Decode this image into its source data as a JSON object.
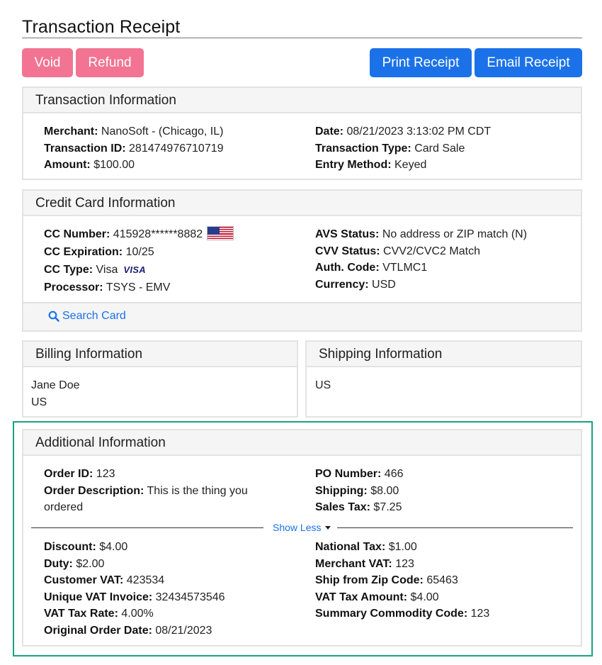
{
  "page": {
    "title": "Transaction Receipt"
  },
  "actions": {
    "void": "Void",
    "refund": "Refund",
    "print_receipt": "Print Receipt",
    "email_receipt": "Email Receipt"
  },
  "transaction": {
    "header": "Transaction Information",
    "merchant_label": "Merchant:",
    "merchant": "NanoSoft - (Chicago, IL)",
    "id_label": "Transaction ID:",
    "id": "281474976710719",
    "amount_label": "Amount:",
    "amount": "$100.00",
    "date_label": "Date:",
    "date": "08/21/2023 3:13:02 PM CDT",
    "type_label": "Transaction Type:",
    "type": "Card Sale",
    "entry_label": "Entry Method:",
    "entry": "Keyed"
  },
  "card": {
    "header": "Credit Card Information",
    "number_label": "CC Number:",
    "number": "415928******8882",
    "number_flag_icon": "us-flag-icon",
    "expiration_label": "CC Expiration:",
    "expiration": "10/25",
    "type_label": "CC Type:",
    "type": "Visa",
    "type_logo": "VISA",
    "processor_label": "Processor:",
    "processor": "TSYS - EMV",
    "avs_label": "AVS Status:",
    "avs": "No address or ZIP match (N)",
    "cvv_label": "CVV Status:",
    "cvv": "CVV2/CVC2 Match",
    "auth_label": "Auth. Code:",
    "auth": "VTLMC1",
    "currency_label": "Currency:",
    "currency": "USD",
    "search_card": "Search Card",
    "search_icon": "search-icon"
  },
  "billing": {
    "header": "Billing Information",
    "name": "Jane Doe",
    "country": "US"
  },
  "shipping": {
    "header": "Shipping Information",
    "country": "US"
  },
  "additional": {
    "header": "Additional Information",
    "order_id_label": "Order ID:",
    "order_id": "123",
    "order_desc_label": "Order Description:",
    "order_desc_line1": "This is the thing you",
    "order_desc_line2": "ordered",
    "po_label": "PO Number:",
    "po": "466",
    "shipping_label": "Shipping:",
    "shipping": "$8.00",
    "sales_tax_label": "Sales Tax:",
    "sales_tax": "$7.25",
    "show_less": "Show Less",
    "discount_label": "Discount:",
    "discount": "$4.00",
    "duty_label": "Duty:",
    "duty": "$2.00",
    "customer_vat_label": "Customer VAT:",
    "customer_vat": "423534",
    "unique_vat_label": "Unique VAT Invoice:",
    "unique_vat": "32434573546",
    "vat_rate_label": "VAT Tax Rate:",
    "vat_rate": "4.00%",
    "orig_date_label": "Original Order Date:",
    "orig_date": "08/21/2023",
    "national_tax_label": "National Tax:",
    "national_tax": "$1.00",
    "merchant_vat_label": "Merchant VAT:",
    "merchant_vat": "123",
    "ship_zip_label": "Ship from Zip Code:",
    "ship_zip": "65463",
    "vat_amount_label": "VAT Tax Amount:",
    "vat_amount": "$4.00",
    "commodity_label": "Summary Commodity Code:",
    "commodity": "123"
  },
  "colors": {
    "pink_button": "#f27492",
    "blue_button": "#1b72e8",
    "highlight_border": "#1aa183",
    "link": "#1b72e8"
  }
}
